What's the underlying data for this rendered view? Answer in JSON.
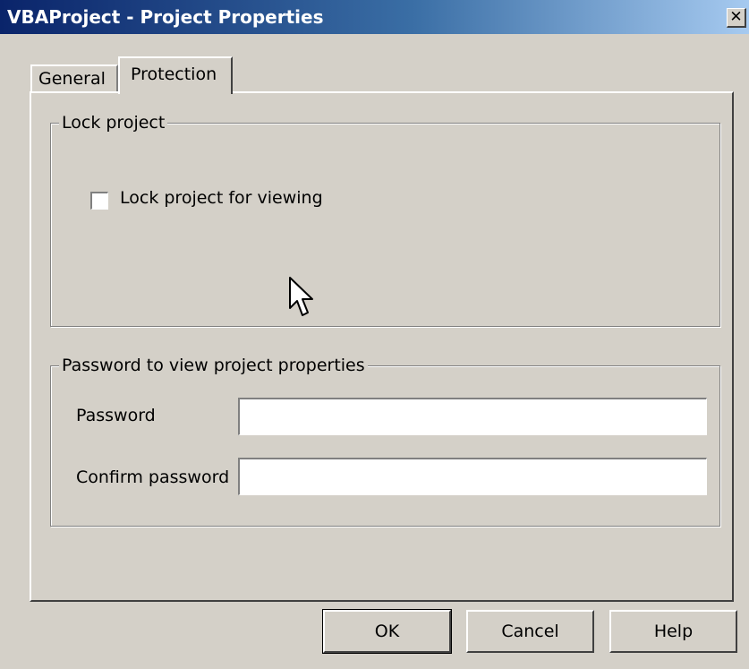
{
  "window": {
    "title": "VBAProject - Project Properties",
    "close_symbol": "✕"
  },
  "tabs": [
    {
      "label": "General",
      "selected": false
    },
    {
      "label": "Protection",
      "selected": true
    }
  ],
  "lock_group": {
    "legend": "Lock project",
    "checkbox_label": "Lock project for viewing",
    "checked": false
  },
  "password_group": {
    "legend": "Password to view project properties",
    "password_label": "Password",
    "password_value": "",
    "confirm_label": "Confirm password",
    "confirm_value": ""
  },
  "buttons": {
    "ok": "OK",
    "cancel": "Cancel",
    "help": "Help"
  },
  "colors": {
    "dialog_face": "#d4d0c8",
    "titlebar_start": "#0a246a",
    "titlebar_end": "#a6caf0"
  },
  "icons": {
    "close": "close-icon",
    "cursor": "mouse-pointer-icon"
  }
}
